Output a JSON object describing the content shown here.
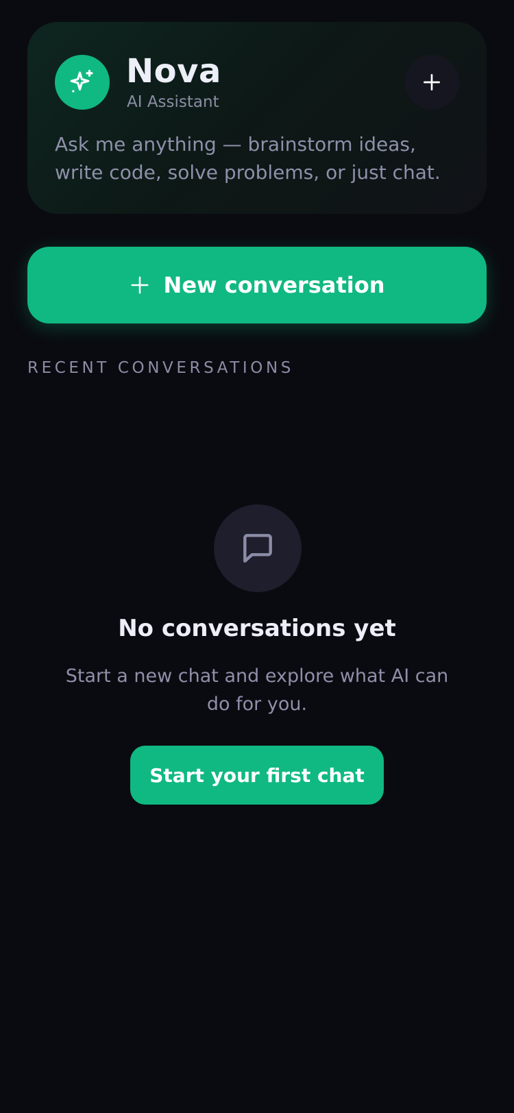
{
  "colors": {
    "background": "#0a0b10",
    "accent": "#10b981",
    "text_primary": "#eceef8",
    "text_secondary": "#8e90aa"
  },
  "header": {
    "logo_icon": "sparkles-icon",
    "title": "Nova",
    "subtitle": "AI Assistant",
    "add_icon": "plus-icon",
    "description": "Ask me anything — brainstorm ideas, write code, solve problems, or just chat."
  },
  "primary_action": {
    "icon": "plus-icon",
    "label": "New conversation"
  },
  "recent": {
    "section_label": "RECENT CONVERSATIONS"
  },
  "empty_state": {
    "icon": "message-square-icon",
    "title": "No conversations yet",
    "description": "Start a new chat and explore what AI can do for you.",
    "button_label": "Start your first chat"
  }
}
